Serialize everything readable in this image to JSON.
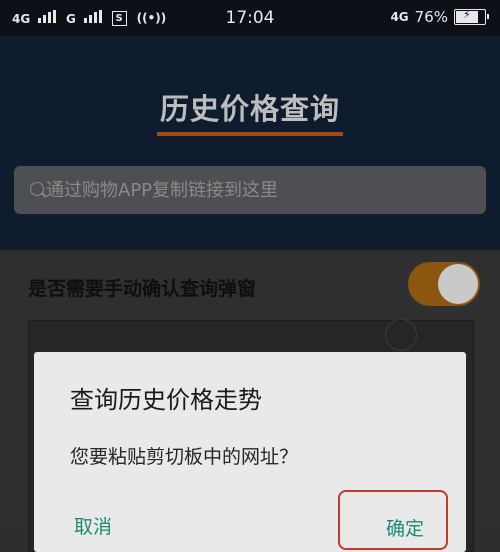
{
  "status_bar": {
    "net1": "4G",
    "net2": "G",
    "sim_badge": "S",
    "hotspot": "((•))",
    "time": "17:04",
    "net_right": "4G",
    "battery_percent": "76%"
  },
  "header": {
    "title": "历史价格查询",
    "search_placeholder": "通过购物APP复制链接到这里"
  },
  "settings": {
    "toggle_label": "是否需要手动确认查询弹窗",
    "toggle_on": true
  },
  "dialog": {
    "title": "查询历史价格走势",
    "message": "您要粘贴剪切板中的网址？",
    "cancel_label": "取消",
    "ok_label": "确定"
  },
  "colors": {
    "accent": "#d08a1a",
    "header_bg": "#0e1c2e",
    "dialog_button": "#1f8a76",
    "highlight": "#c0392b"
  },
  "icons": [
    "signal-icon",
    "sim-icon",
    "hotspot-icon",
    "battery-icon",
    "search-icon"
  ]
}
